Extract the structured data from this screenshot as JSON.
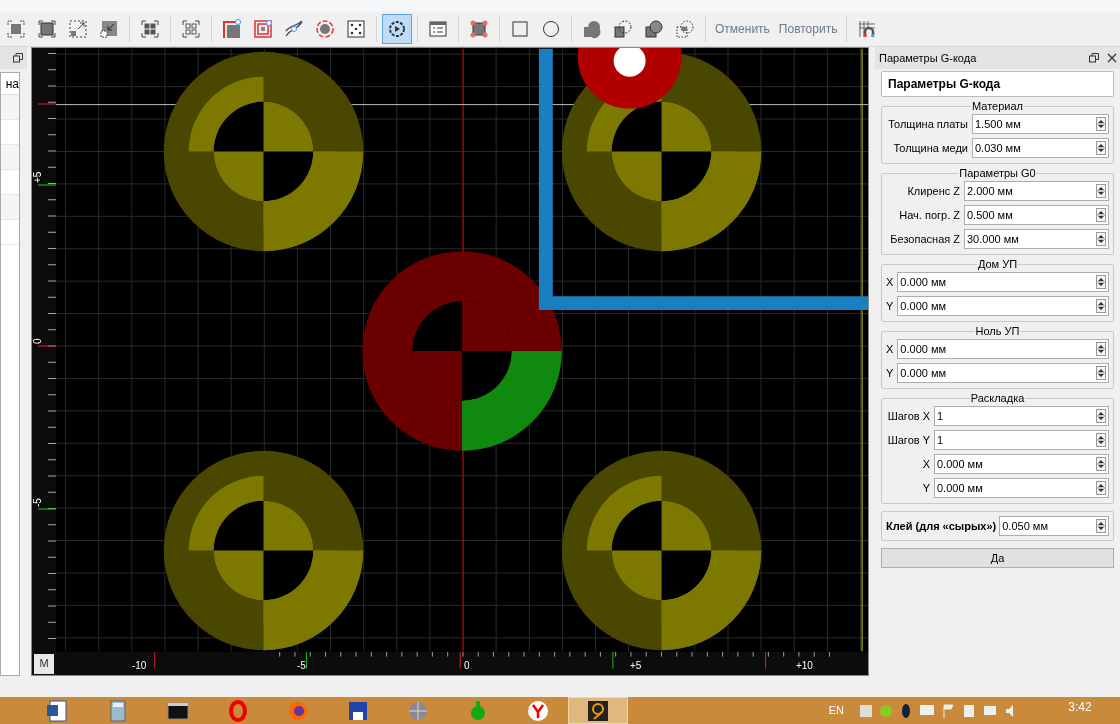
{
  "toolbar": {
    "tools": [
      {
        "selected": false
      },
      {
        "selected": false
      },
      {
        "selected": false
      },
      {
        "selected": false
      },
      {
        "selected": false
      },
      {
        "selected": false
      },
      {
        "selected": false
      },
      {
        "selected": false
      },
      {
        "selected": false
      },
      {
        "selected": false
      },
      {
        "selected": false
      },
      {
        "selected": true
      },
      {
        "selected": false
      },
      {
        "selected": false
      },
      {
        "selected": false
      },
      {
        "selected": false
      },
      {
        "selected": false
      },
      {
        "selected": false
      },
      {
        "selected": false
      },
      {
        "selected": false
      }
    ],
    "undo": "Отменить",
    "redo": "Повторить"
  },
  "left_panel": {
    "column_1": "на"
  },
  "canvas": {
    "corner": "M",
    "x_labels": [
      "-10",
      "-5",
      "0",
      "+5",
      "+10"
    ],
    "y_labels": [
      "+5",
      "0",
      "-5"
    ]
  },
  "right_panel": {
    "title": "Параметры G-кода",
    "heading": "Параметры G-кода",
    "groups": [
      {
        "legend": "Материал",
        "fields": [
          {
            "label": "Толщина платы",
            "value": "1.500 мм"
          },
          {
            "label": "Толщина меди",
            "value": "0.030 мм"
          }
        ]
      },
      {
        "legend": "Параметры G0",
        "fields": [
          {
            "label": "Клиренс Z",
            "value": "2.000 мм"
          },
          {
            "label": "Нач. погр. Z",
            "value": "0.500 мм"
          },
          {
            "label": "Безопасная Z",
            "value": "30.000 мм"
          }
        ]
      },
      {
        "legend": "Дом УП",
        "fields": [
          {
            "label": "X",
            "value": "0.000 мм"
          },
          {
            "label": "Y",
            "value": "0.000 мм"
          }
        ]
      },
      {
        "legend": "Ноль УП",
        "fields": [
          {
            "label": "X",
            "value": "0.000 мм"
          },
          {
            "label": "Y",
            "value": "0.000 мм"
          }
        ]
      },
      {
        "legend": "Раскладка",
        "fields": [
          {
            "label": "Шагов X",
            "value": "1"
          },
          {
            "label": "Шагов Y",
            "value": "1"
          },
          {
            "label": "X",
            "value": "0.000 мм"
          },
          {
            "label": "Y",
            "value": "0.000 мм"
          }
        ]
      }
    ],
    "glue": {
      "label": "Клей (для «сырых»)",
      "value": "0.050 мм"
    },
    "ok_button": "Да"
  },
  "taskbar": {
    "apps": [
      {
        "selected": false
      },
      {
        "selected": false
      },
      {
        "selected": false
      },
      {
        "selected": false
      },
      {
        "selected": false
      },
      {
        "selected": false
      },
      {
        "selected": false
      },
      {
        "selected": false
      },
      {
        "selected": false
      },
      {
        "selected": true
      }
    ],
    "language": "EN",
    "time": "3:42"
  }
}
